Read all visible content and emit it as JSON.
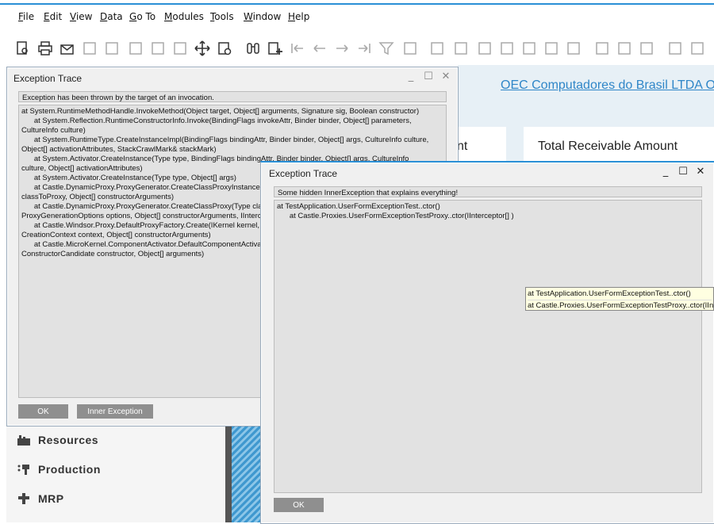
{
  "menu": [
    {
      "label": "File",
      "u": "F",
      "rest": "ile"
    },
    {
      "label": "Edit",
      "u": "E",
      "rest": "dit"
    },
    {
      "label": "View",
      "u": "V",
      "rest": "iew"
    },
    {
      "label": "Data",
      "u": "D",
      "rest": "ata"
    },
    {
      "label": "Go To",
      "u": "G",
      "rest": "o To"
    },
    {
      "label": "Modules",
      "u": "M",
      "rest": "odules"
    },
    {
      "label": "Tools",
      "u": "T",
      "rest": "ools"
    },
    {
      "label": "Window",
      "u": "W",
      "rest": "indow"
    },
    {
      "label": "Help",
      "u": "H",
      "rest": "elp"
    }
  ],
  "toolbar_icons": [
    "preview-icon",
    "print-icon",
    "email-icon",
    "sms-icon",
    "fax-icon",
    "excel-icon",
    "word-icon",
    "pdf-icon",
    "move-icon",
    "settings-icon",
    "find-icon",
    "add-icon",
    "first-record-icon",
    "previous-record-icon",
    "next-record-icon",
    "last-record-icon",
    "filter-icon",
    "sort-icon",
    "base-document-icon",
    "target-document-icon",
    "layout-icon",
    "payment-means-icon",
    "balance-icon",
    "gross-profit-icon",
    "query-icon",
    "edit-icon",
    "form-settings-icon",
    "document-settings-icon",
    "approve-icon",
    "message-icon"
  ],
  "cockpit": {
    "company_link": "OEC Computadores do Brasil LTDA",
    "company_link_overflow": "O",
    "tile1_label": "nt",
    "tile2_label": "Total Receivable Amount"
  },
  "modules": [
    {
      "label": "Resources",
      "icon": "resources-icon"
    },
    {
      "label": "Production",
      "icon": "production-icon"
    },
    {
      "label": "MRP",
      "icon": "mrp-icon"
    }
  ],
  "dialog1": {
    "title": "Exception Trace",
    "message": "Exception has been thrown by the target of an invocation.",
    "trace": [
      "at System.RuntimeMethodHandle.InvokeMethod(Object target, Object[] arguments, Signature sig, Boolean constructor)",
      "   at System.Reflection.RuntimeConstructorInfo.Invoke(BindingFlags invokeAttr, Binder binder, Object[] parameters,",
      "CultureInfo culture)",
      "   at System.RuntimeType.CreateInstanceImpl(BindingFlags bindingAttr, Binder binder, Object[] args, CultureInfo culture,",
      "Object[] activationAttributes, StackCrawlMark& stackMark)",
      "   at System.Activator.CreateInstance(Type type, BindingFlags bindingAttr, Binder binder, Object[] args, CultureInfo",
      "culture, Object[] activationAttributes)",
      "   at System.Activator.CreateInstance(Type type, Object[] args)",
      "   at Castle.DynamicProxy.ProxyGenerator.CreateClassProxyInstance(Type proxyType, List`1 proxyArguments, Type",
      "classToProxy, Object[] constructorArguments)",
      "   at Castle.DynamicProxy.ProxyGenerator.CreateClassProxy(Type classToProxy, Type[] additionalInterfacesToProxy,",
      "ProxyGenerationOptions options, Object[] constructorArguments, IInterceptor[] interceptors)",
      "   at Castle.Windsor.Proxy.DefaultProxyFactory.Create(IKernel kernel, Object target, ComponentModel model,",
      "CreationContext context, Object[] constructorArguments)",
      "   at Castle.MicroKernel.ComponentActivator.DefaultComponentActivator.CreateInstanceCore(ConstructorCandidate",
      "ConstructorCandidate constructor, Object[] arguments)"
    ],
    "ok_label": "OK",
    "inner_label": "Inner Exception"
  },
  "dialog2": {
    "title": "Exception Trace",
    "message": "Some hidden InnerException that explains everything!",
    "trace": [
      "at TestApplication.UserFormExceptionTest..ctor()",
      "   at Castle.Proxies.UserFormExceptionTestProxy..ctor(IInterceptor[] )"
    ],
    "ok_label": "OK"
  },
  "tooltip": [
    "at TestApplication.UserFormExceptionTest..ctor()",
    "at Castle.Proxies.UserFormExceptionTestProxy..ctor(IInterceptor[] )"
  ],
  "colors": {
    "accent": "#2a8fd6",
    "link": "#2f86c8",
    "button": "#8f8f8f",
    "tooltip_bg": "#ffffe1"
  }
}
